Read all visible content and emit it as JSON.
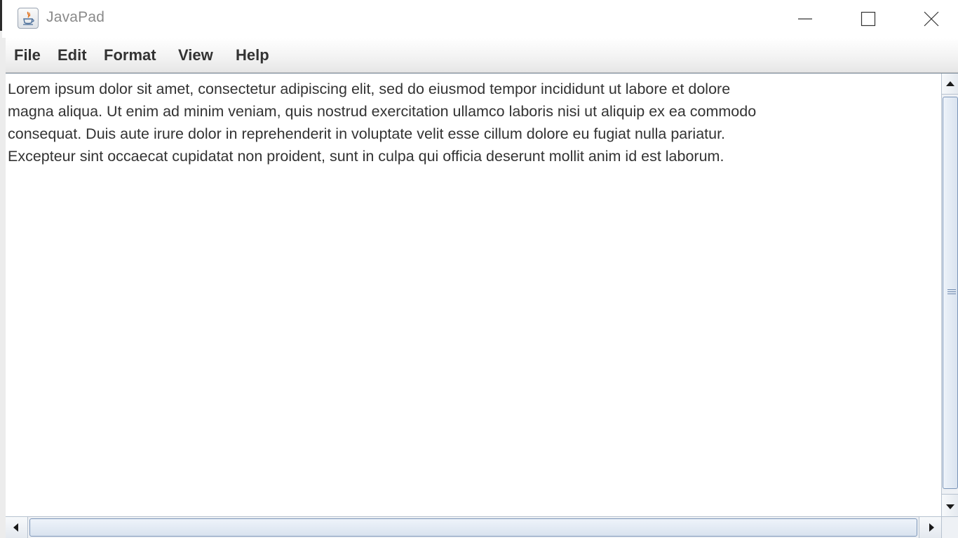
{
  "window": {
    "title": "JavaPad",
    "app_icon": "java-cup-icon",
    "controls": [
      "minimize-icon",
      "maximize-icon",
      "close-icon"
    ]
  },
  "menubar": {
    "items": [
      {
        "label": "File"
      },
      {
        "label": "Edit"
      },
      {
        "label": "Format"
      },
      {
        "label": "View"
      },
      {
        "label": "Help"
      }
    ]
  },
  "editor": {
    "content": "Lorem ipsum dolor sit amet, consectetur adipiscing elit, sed do eiusmod tempor incididunt ut labore et dolore\nmagna aliqua. Ut enim ad minim veniam, quis nostrud exercitation ullamco laboris nisi ut aliquip ex ea commodo\nconsequat. Duis aute irure dolor in reprehenderit in voluptate velit esse cillum dolore eu fugiat nulla pariatur.\nExcepteur sint occaecat cupidatat non proident, sunt in culpa qui officia deserunt mollit anim id est laborum."
  },
  "colors": {
    "scroll_thumb_border": "#7b95b8",
    "text": "#333333",
    "title_text": "#8a8a8a"
  }
}
